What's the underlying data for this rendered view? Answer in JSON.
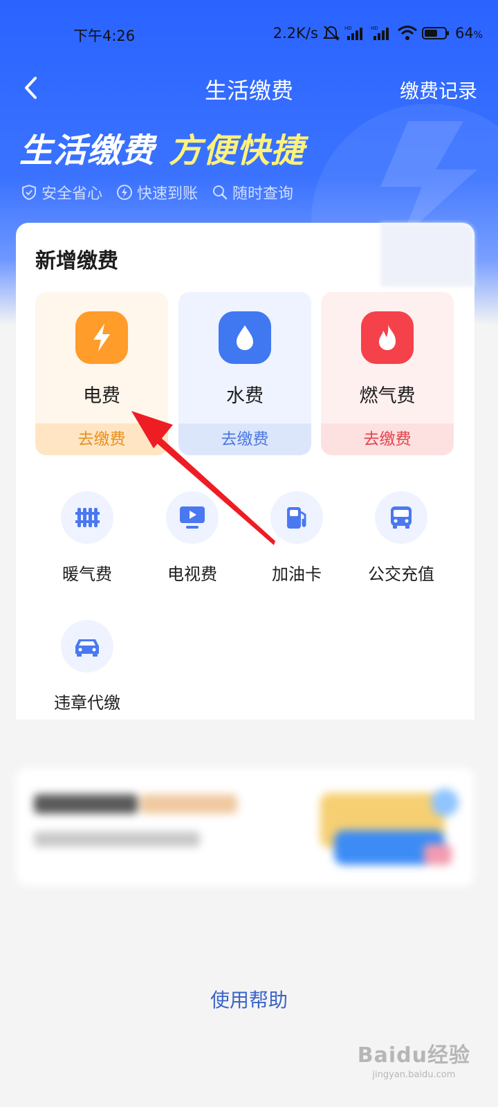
{
  "status": {
    "time": "下午4:26",
    "net_speed": "2.2K/s",
    "battery": "64",
    "battery_unit": "%",
    "battery_level": 0.64
  },
  "nav": {
    "title": "生活缴费",
    "right_label": "缴费记录"
  },
  "banner": {
    "slogan_white": "生活缴费",
    "slogan_yellow": "方便快捷",
    "features": [
      {
        "label": "安全省心",
        "icon": "shield-check-icon"
      },
      {
        "label": "快速到账",
        "icon": "lightning-circle-icon"
      },
      {
        "label": "随时查询",
        "icon": "search-icon"
      }
    ]
  },
  "card": {
    "title": "新增缴费",
    "main_tiles": [
      {
        "label": "电费",
        "cta": "去缴费",
        "icon": "lightning-icon",
        "bg": "#fff6ec",
        "icon_bg": "#ff9c2a",
        "cta_bg": "#ffe5c4",
        "cta_color": "#e7921f"
      },
      {
        "label": "水费",
        "cta": "去缴费",
        "icon": "water-drop-icon",
        "bg": "#eef3ff",
        "icon_bg": "#3f78f0",
        "cta_bg": "#dce6fb",
        "cta_color": "#4b78e0"
      },
      {
        "label": "燃气费",
        "cta": "去缴费",
        "icon": "flame-icon",
        "bg": "#fff0f0",
        "icon_bg": "#f5414a",
        "cta_bg": "#fde0e0",
        "cta_color": "#e0464c"
      }
    ],
    "other_items": [
      {
        "label": "暖气费",
        "icon": "radiator-icon"
      },
      {
        "label": "电视费",
        "icon": "tv-icon"
      },
      {
        "label": "加油卡",
        "icon": "fuel-pump-icon"
      },
      {
        "label": "公交充值",
        "icon": "bus-icon"
      },
      {
        "label": "违章代缴",
        "icon": "car-icon"
      }
    ]
  },
  "help_link": "使用帮助",
  "watermark": {
    "main": "Baidu经验",
    "sub": "jingyan.baidu.com"
  },
  "colors": {
    "primary": "#2a63ff",
    "accent_yellow": "#fff27a",
    "annotation_red": "#ee1d24",
    "icon_blue": "#4a78f0",
    "link_blue": "#3a64c8"
  }
}
